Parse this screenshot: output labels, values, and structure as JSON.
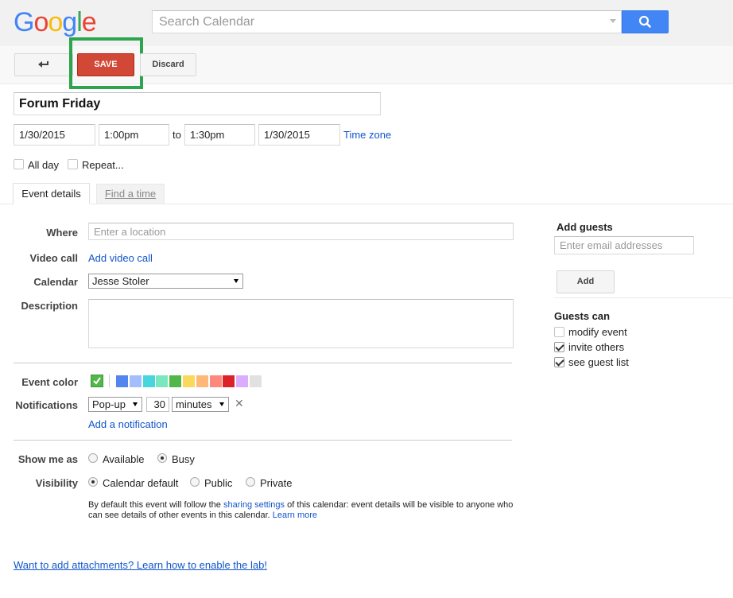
{
  "header": {
    "logo": [
      "G",
      "o",
      "o",
      "g",
      "l",
      "e"
    ],
    "logo_colors": [
      "#4285f4",
      "#ea4335",
      "#fbbc05",
      "#4285f4",
      "#34a853",
      "#ea4335"
    ],
    "search_placeholder": "Search Calendar"
  },
  "toolbar": {
    "back_icon": "back-arrow-icon",
    "save_label": "SAVE",
    "discard_label": "Discard"
  },
  "event": {
    "title": "Forum Friday",
    "start_date": "1/30/2015",
    "start_time": "1:00pm",
    "to_label": "to",
    "end_time": "1:30pm",
    "end_date": "1/30/2015",
    "timezone_link": "Time zone",
    "all_day_label": "All day",
    "repeat_label": "Repeat..."
  },
  "tabs": [
    {
      "label": "Event details",
      "active": true
    },
    {
      "label": "Find a time",
      "active": false
    }
  ],
  "details": {
    "where_label": "Where",
    "where_placeholder": "Enter a location",
    "video_label": "Video call",
    "video_link": "Add video call",
    "calendar_label": "Calendar",
    "calendar_value": "Jesse Stoler",
    "description_label": "Description",
    "color_label": "Event color",
    "colors": [
      "#5484ed",
      "#a4bdfc",
      "#46d6db",
      "#7ae7bf",
      "#51b749",
      "#fbd75b",
      "#ffb878",
      "#ff887c",
      "#dc2127",
      "#dbadff",
      "#e1e1e1"
    ],
    "notifications_label": "Notifications",
    "notif_type": "Pop-up",
    "notif_number": "30",
    "notif_unit": "minutes",
    "add_notification": "Add a notification",
    "show_me_as_label": "Show me as",
    "show_available": "Available",
    "show_busy": "Busy",
    "visibility_label": "Visibility",
    "vis_default": "Calendar default",
    "vis_public": "Public",
    "vis_private": "Private",
    "vis_note_1": "By default this event will follow the ",
    "vis_note_link1": "sharing settings",
    "vis_note_2": " of this calendar: event details will be visible to anyone who can see details of other events in this calendar.  ",
    "vis_note_link2": "Learn more"
  },
  "attachments_link": "Want to add attachments? Learn how to enable the lab!",
  "guests": {
    "title": "Add guests",
    "placeholder": "Enter email addresses",
    "add_button": "Add",
    "can_title": "Guests can",
    "modify": "modify event",
    "invite": "invite others",
    "see_list": "see guest list"
  }
}
